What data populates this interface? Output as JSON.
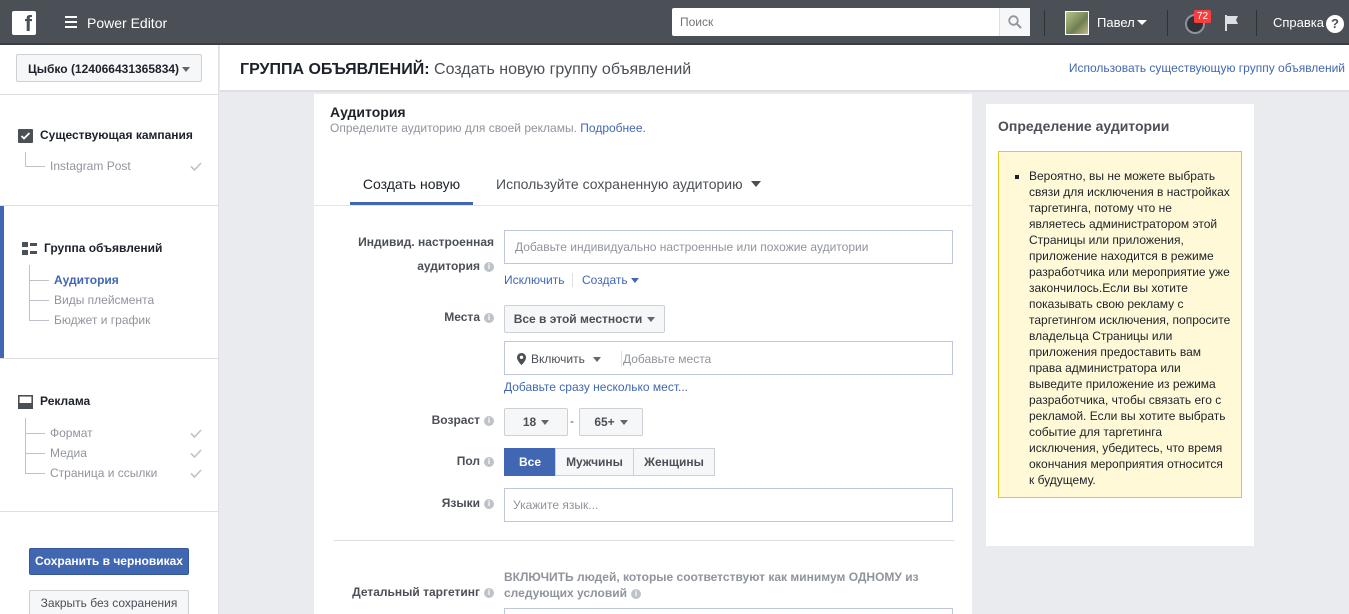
{
  "topbar": {
    "logo": "f",
    "app_title": "Power Editor",
    "search_placeholder": "Поиск",
    "user_name": "Павел",
    "notifications_count": "72",
    "help_label": "Справка",
    "help_icon": "?"
  },
  "sidebar": {
    "account": "Цыбко (124066431365834)",
    "campaign": {
      "label": "Существующая кампания",
      "items": [
        {
          "label": "Instagram Post",
          "done": true
        }
      ]
    },
    "adset": {
      "label": "Группа объявлений",
      "items": [
        {
          "label": "Аудитория",
          "active": true
        },
        {
          "label": "Виды плейсмента"
        },
        {
          "label": "Бюджет и график"
        }
      ]
    },
    "ad": {
      "label": "Реклама",
      "items": [
        {
          "label": "Формат",
          "done": true
        },
        {
          "label": "Медиа",
          "done": true
        },
        {
          "label": "Страница и ссылки",
          "done": true
        }
      ]
    },
    "save_draft_label": "Сохранить в черновиках",
    "close_label": "Закрыть без сохранения"
  },
  "header": {
    "title_prefix": "ГРУППА ОБЪЯВЛЕНИЙ:",
    "title_text": "Создать новую группу объявлений",
    "use_existing_link": "Использовать существующую группу объявлений"
  },
  "audience": {
    "title": "Аудитория",
    "subtitle": "Определите аудиторию для своей рекламы.",
    "more_link": "Подробнее.",
    "tabs": [
      "Создать новую",
      "Используйте сохраненную аудиторию"
    ],
    "custom_audience": {
      "label_line1": "Индивид. настроенная",
      "label_line2": "аудитория",
      "placeholder": "Добавьте индивидуально настроенные или похожие аудитории",
      "exclude_link": "Исключить",
      "create_link": "Создать"
    },
    "locations": {
      "label": "Места",
      "scope": "Все в этой местности",
      "include": "Включить",
      "placeholder": "Добавьте места",
      "bulk_link": "Добавьте сразу несколько мест..."
    },
    "age": {
      "label": "Возраст",
      "min": "18",
      "dash": "-",
      "max": "65+"
    },
    "gender": {
      "label": "Пол",
      "options": [
        "Все",
        "Мужчины",
        "Женщины"
      ],
      "selected": "Все"
    },
    "languages": {
      "label": "Языки",
      "placeholder": "Укажите язык..."
    },
    "detailed": {
      "label": "Детальный таргетинг",
      "line1": "ВКЛЮЧИТЬ людей, которые соответствуют как минимум ОДНОМУ из",
      "line2": "следующих условий"
    }
  },
  "definition": {
    "title": "Определение аудитории",
    "note": "Вероятно, вы не можете выбрать связи для исключения в настройках таргетинга, потому что не являетесь администратором этой Страницы или приложения, приложение находится в режиме разработчика или мероприятие уже закончилось.Если вы хотите показывать свою рекламу с таргетингом исключения, попросите владельца Страницы или приложения предоставить вам права администратора или выведите приложение из режима разработчика, чтобы связать его с рекламой. Если вы хотите выбрать событие для таргетинга исключения, убедитесь, что время окончания мероприятия относится к будущему."
  },
  "colors": {
    "accent": "#4267b2",
    "topbar": "#4b4f56",
    "badge": "#fa3e3e",
    "note_bg": "#fff9d7",
    "note_border": "#e2c822"
  }
}
